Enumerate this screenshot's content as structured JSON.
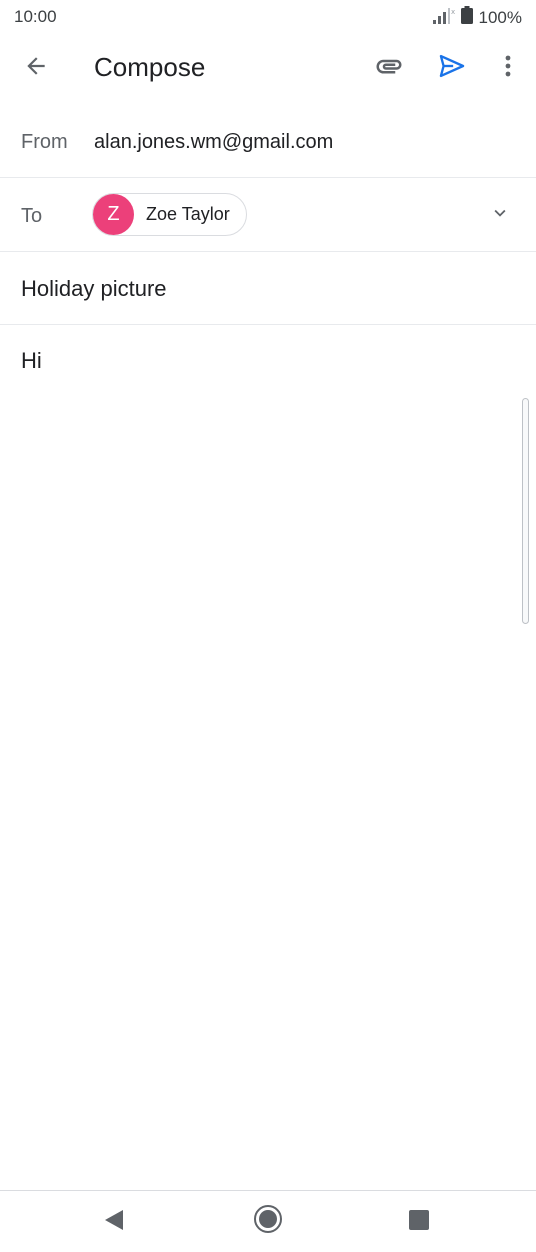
{
  "status_bar": {
    "time": "10:00",
    "battery_text": "100%",
    "icons": [
      "signal-icon",
      "battery-icon"
    ]
  },
  "app_bar": {
    "title": "Compose",
    "icons": [
      "back-arrow-icon",
      "paperclip-icon",
      "send-icon",
      "more-vert-icon"
    ],
    "accent_color": "#1a73e8"
  },
  "compose": {
    "from_label": "From",
    "from_value": "alan.jones.wm@gmail.com",
    "to_label": "To",
    "recipient": {
      "initial": "Z",
      "name": "Zoe Taylor",
      "avatar_color": "#ec407a"
    },
    "subject": "Holiday picture",
    "body": "Hi"
  },
  "nav_bar": {
    "icons": [
      "nav-back-icon",
      "nav-home-icon",
      "nav-recents-icon"
    ]
  }
}
